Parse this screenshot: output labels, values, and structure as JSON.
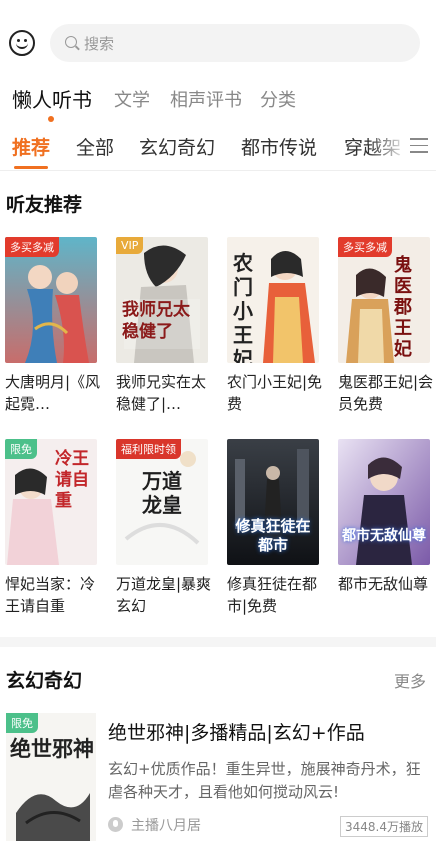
{
  "search": {
    "placeholder": "搜索"
  },
  "main_tabs": [
    {
      "label": "懒人听书",
      "active": true
    },
    {
      "label": "文学"
    },
    {
      "label": "相声评书"
    },
    {
      "label": "分类"
    }
  ],
  "sub_tabs": [
    {
      "label": "推荐",
      "active": true
    },
    {
      "label": "全部"
    },
    {
      "label": "玄幻奇幻"
    },
    {
      "label": "都市传说"
    },
    {
      "label": "穿越架"
    }
  ],
  "section1": {
    "title": "听友推荐",
    "items": [
      {
        "title": "大唐明月|《风起霓…",
        "badge": "多买多减",
        "cover_text": ""
      },
      {
        "title": "我师兄实在太稳健了|…",
        "badge": "VIP",
        "cover_text": "我师兄太稳健了"
      },
      {
        "title": "农门小王妃|免费",
        "badge": "",
        "cover_text": "农门小王妃"
      },
      {
        "title": "鬼医郡王妃|会员免费",
        "badge": "多买多减",
        "cover_text": "鬼医郡王妃"
      },
      {
        "title": "悍妃当家：冷王请自重",
        "badge": "限免",
        "cover_text": "冷王请自重"
      },
      {
        "title": "万道龙皇|暴爽玄幻",
        "badge": "福利限时领",
        "cover_text": "万道龙皇"
      },
      {
        "title": "修真狂徒在都市|免费",
        "badge": "",
        "cover_text": "修真狂徒在都市"
      },
      {
        "title": "都市无敌仙尊",
        "badge": "",
        "cover_text": "都市无敌仙尊"
      }
    ]
  },
  "section2": {
    "title": "玄幻奇幻",
    "more": "更多",
    "item": {
      "badge": "限免",
      "cover_text": "绝世邪神",
      "title": "绝世邪神|多播精品|玄幻+作品",
      "desc": "玄幻+优质作品！重生异世，施展神奇丹术，狂虐各种天才，且看他如何搅动风云!",
      "host": "主播八月居",
      "plays": "3448.4万播放"
    }
  },
  "colors": {
    "accent": "#f07020",
    "badge_red": "#e23b2c",
    "badge_vip": "#e8aa3a",
    "badge_green": "#4cc08a"
  }
}
